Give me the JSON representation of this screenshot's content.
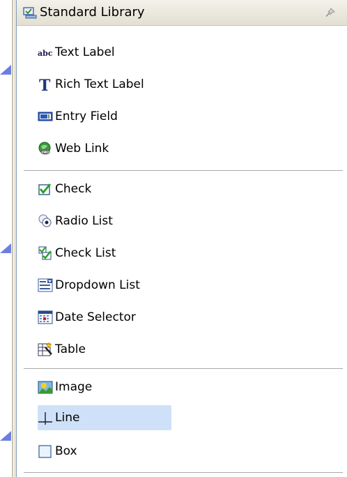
{
  "palette": {
    "title": "Standard Library",
    "groups": [
      [
        {
          "label": "Text Label",
          "icon": "text-label-icon"
        },
        {
          "label": "Rich Text Label",
          "icon": "rich-text-icon"
        },
        {
          "label": "Entry Field",
          "icon": "entry-field-icon"
        },
        {
          "label": "Web Link",
          "icon": "web-link-icon"
        }
      ],
      [
        {
          "label": "Check",
          "icon": "check-icon"
        },
        {
          "label": "Radio List",
          "icon": "radio-list-icon"
        },
        {
          "label": "Check List",
          "icon": "check-list-icon"
        },
        {
          "label": "Dropdown List",
          "icon": "dropdown-list-icon"
        },
        {
          "label": "Date Selector",
          "icon": "date-selector-icon"
        },
        {
          "label": "Table",
          "icon": "table-icon"
        }
      ],
      [
        {
          "label": "Image",
          "icon": "image-icon"
        },
        {
          "label": "Line",
          "icon": "line-icon",
          "selected": true
        },
        {
          "label": "Box",
          "icon": "box-icon"
        }
      ]
    ]
  }
}
